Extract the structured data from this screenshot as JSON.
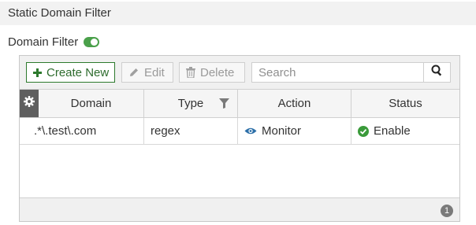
{
  "section": {
    "title": "Static Domain Filter"
  },
  "domain_filter": {
    "label": "Domain Filter",
    "enabled": true
  },
  "toolbar": {
    "create_label": "Create New",
    "edit_label": "Edit",
    "delete_label": "Delete",
    "search_placeholder": "Search"
  },
  "table": {
    "columns": [
      "Domain",
      "Type",
      "Action",
      "Status"
    ],
    "rows": [
      {
        "domain": ".*\\.test\\.com",
        "type": "regex",
        "action": "Monitor",
        "status": "Enable"
      }
    ],
    "count": "1"
  },
  "icons": {
    "create": "plus-icon",
    "edit": "pencil-icon",
    "delete": "trash-icon",
    "search": "search-icon",
    "settings": "gear-icon",
    "filter": "filter-icon",
    "monitor": "eye-icon",
    "status": "check-circle-icon"
  },
  "colors": {
    "accent": "#4aa04a",
    "create_border": "#2d7a2d",
    "monitor": "#2c6fa8"
  }
}
